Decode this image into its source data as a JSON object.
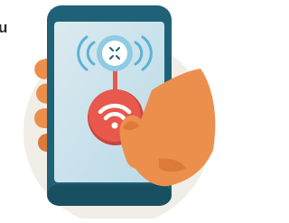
{
  "edge_text": "u",
  "colors": {
    "backdrop_circle": "#f1ede7",
    "hand_skin": "#ec8f4c",
    "hand_skin_shade": "#dc7a3a",
    "phone_frame": "#1f6277",
    "phone_frame_dark": "#184f61",
    "screen_background": "#dceaf0",
    "screen_gradient_end": "#b9dae7",
    "signal_waves": "#5bb2d6",
    "top_button_ring": "#8fcbe3",
    "top_button_fill": "#ffffff",
    "top_button_icon": "#1f6277",
    "connector_line": "#e8584d",
    "main_button": "#e8584d",
    "main_button_dark": "#c8463c",
    "main_button_icon": "#ffffff"
  },
  "icons": [
    "move-arrows-icon",
    "wifi-icon",
    "signal-waves-icon"
  ]
}
